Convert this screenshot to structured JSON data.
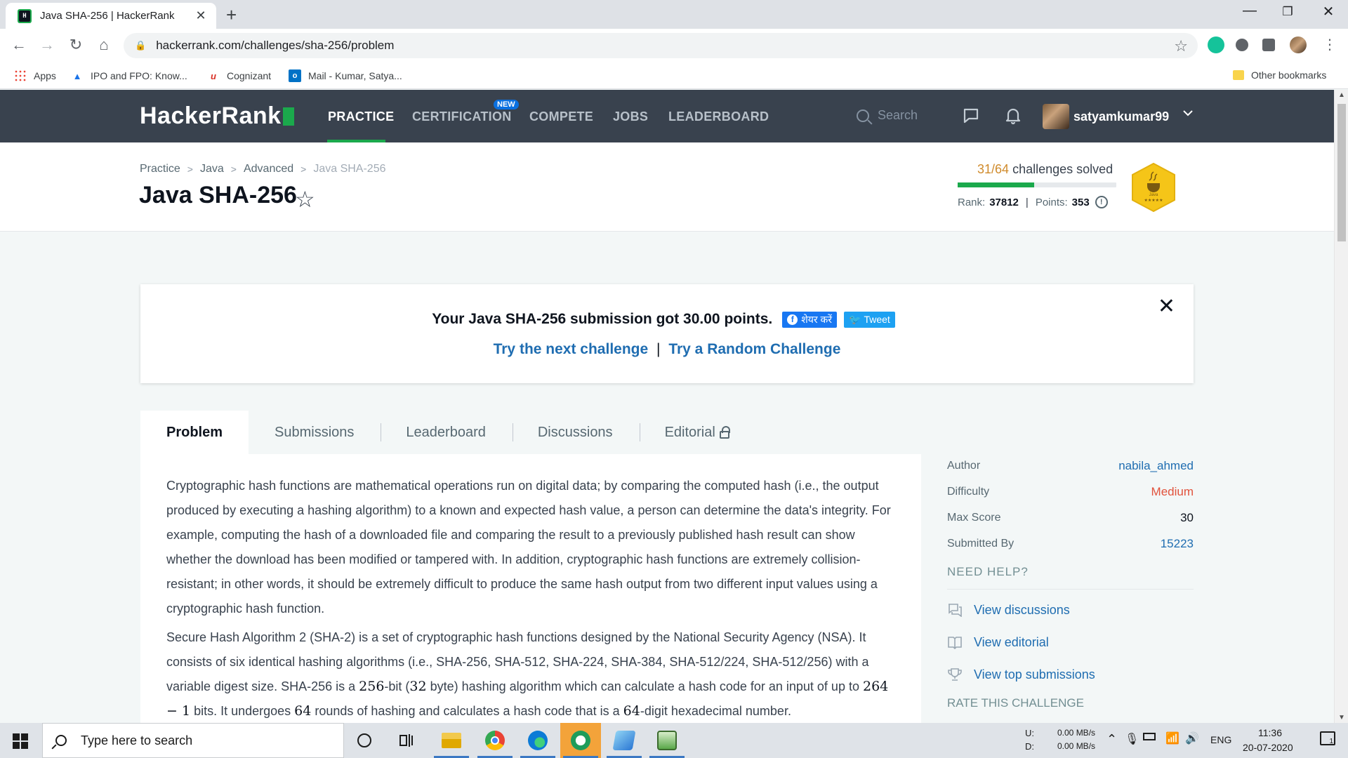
{
  "browser": {
    "tab_title": "Java SHA-256 | HackerRank",
    "favicon_text": "H",
    "url": "hackerrank.com/challenges/sha-256/problem",
    "bookmarks": [
      "Apps",
      "IPO and FPO: Know...",
      "Cognizant",
      "Mail - Kumar, Satya..."
    ],
    "other_bookmarks": "Other bookmarks"
  },
  "header": {
    "logo": "HackerRank",
    "nav": [
      "PRACTICE",
      "CERTIFICATION",
      "COMPETE",
      "JOBS",
      "LEADERBOARD"
    ],
    "new_badge": "NEW",
    "search_placeholder": "Search",
    "username": "satyamkumar99"
  },
  "titlebar": {
    "breadcrumb": [
      "Practice",
      "Java",
      "Advanced",
      "Java SHA-256"
    ],
    "title": "Java SHA-256",
    "solved_count": "31/64",
    "solved_label": "challenges solved",
    "progress_fraction": 0.484,
    "rank_label": "Rank:",
    "rank_value": "37812",
    "points_label": "Points:",
    "points_value": "353",
    "badge_label": "Java"
  },
  "banner": {
    "message": "Your Java SHA-256 submission got 30.00 points.",
    "share_fb": "शेयर करें",
    "share_tweet": "Tweet",
    "link_next": "Try the next challenge",
    "link_separator": "|",
    "link_random": "Try a Random Challenge"
  },
  "tabs": [
    "Problem",
    "Submissions",
    "Leaderboard",
    "Discussions",
    "Editorial"
  ],
  "problem": {
    "para1": "Cryptographic hash functions are mathematical operations run on digital data; by comparing the computed hash (i.e., the output produced by executing a hashing algorithm) to a known and expected hash value, a person can determine the data's integrity. For example, computing the hash of a downloaded file and comparing the result to a previously published hash result can show whether the download has been modified or tampered with. In addition, cryptographic hash functions are extremely collision-resistant; in other words, it should be extremely difficult to produce the same hash output from two different input values using a cryptographic hash function.",
    "para2_a": "Secure Hash Algorithm 2 (SHA-2) is a set of cryptographic hash functions designed by the National Security Agency (NSA). It consists of six identical hashing algorithms (i.e., SHA-256, SHA-512, SHA-224, SHA-384, SHA-512/224, SHA-512/256) with a variable digest size. SHA-256 is a ",
    "para2_m1": "256",
    "para2_b": "-bit (",
    "para2_m2": "32",
    "para2_c": " byte) hashing algorithm which can calculate a hash code for an input of up to ",
    "para2_m3": "264 − 1",
    "para2_d": " bits. It undergoes ",
    "para2_m4": "64",
    "para2_e": " rounds of hashing and calculates a hash code that is a ",
    "para2_m5": "64",
    "para2_f": "-digit hexadecimal number."
  },
  "sidebar": {
    "details": [
      {
        "label": "Author",
        "value": "nabila_ahmed"
      },
      {
        "label": "Difficulty",
        "value": "Medium"
      },
      {
        "label": "Max Score",
        "value": "30"
      },
      {
        "label": "Submitted By",
        "value": "15223"
      }
    ],
    "need_help": "NEED HELP?",
    "help_links": [
      "View discussions",
      "View editorial",
      "View top submissions"
    ],
    "rate": "RATE THIS CHALLENGE"
  },
  "taskbar": {
    "search_placeholder": "Type here to search",
    "net_u_label": "U:",
    "net_d_label": "D:",
    "net_u": "0.00 MB/s",
    "net_d": "0.00 MB/s",
    "lang": "ENG",
    "time": "11:36",
    "date": "20-07-2020",
    "notif_count": "1"
  },
  "colors": {
    "brand_green": "#1ba94c",
    "header_bg": "#39424e",
    "link_blue": "#1f6db1",
    "difficulty_medium": "#e1523c",
    "badge_gold": "#f5c518"
  }
}
